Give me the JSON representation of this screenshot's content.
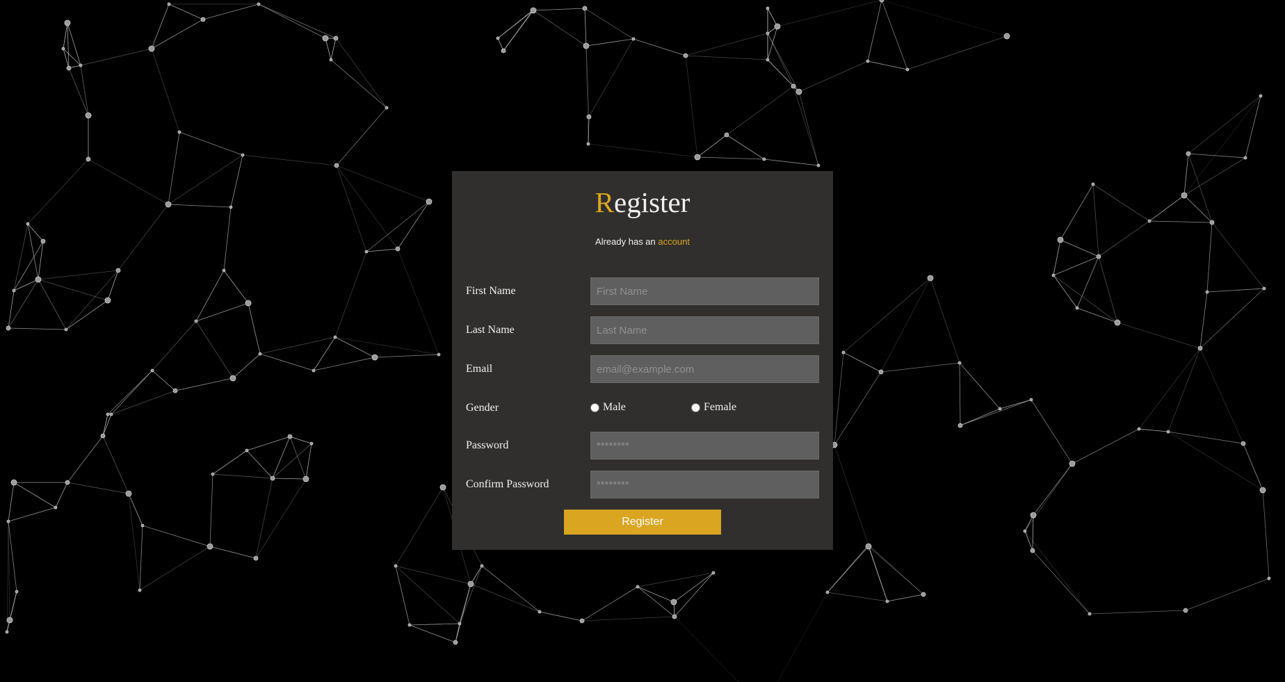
{
  "register": {
    "title_first_letter": "R",
    "title_rest": "egister",
    "subtitle_text": "Already has an",
    "subtitle_link": "account",
    "submit_label": "Register"
  },
  "fields": {
    "first_name": {
      "label": "First Name",
      "placeholder": "First Name",
      "value": ""
    },
    "last_name": {
      "label": "Last Name",
      "placeholder": "Last Name",
      "value": ""
    },
    "email": {
      "label": "Email",
      "placeholder": "email@example.com",
      "value": ""
    },
    "gender": {
      "label": "Gender",
      "options": [
        "Male",
        "Female"
      ],
      "selected": ""
    },
    "password": {
      "label": "Password",
      "placeholder": "********",
      "value": ""
    },
    "confirm_password": {
      "label": "Confirm Password",
      "placeholder": "********",
      "value": ""
    }
  },
  "colors": {
    "accent": "#daa520",
    "panel": "#302f2e",
    "input_bg": "#5f5f5f",
    "background": "#000000",
    "network": "#bdbdbd"
  },
  "background": {
    "decoration": "particle-network"
  }
}
